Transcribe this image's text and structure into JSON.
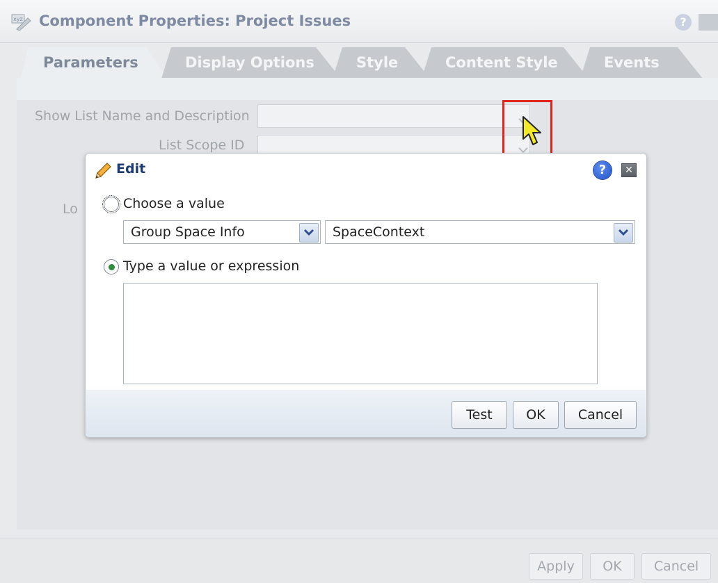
{
  "window": {
    "title": "Component Properties: Project Issues",
    "help_label": "?",
    "close_label": "✕"
  },
  "tabs": [
    {
      "label": "Parameters",
      "active": true
    },
    {
      "label": "Display Options",
      "active": false
    },
    {
      "label": "Style",
      "active": false
    },
    {
      "label": "Content Style",
      "active": false
    },
    {
      "label": "Events",
      "active": false
    }
  ],
  "form": {
    "field1_label": "Show List Name and Description",
    "field2_label": "List Scope ID",
    "field3_label_fragment": "Lo"
  },
  "bottom_buttons": {
    "apply": "Apply",
    "ok": "OK",
    "cancel": "Cancel"
  },
  "dialog": {
    "title": "Edit",
    "help_label": "?",
    "close_label": "✕",
    "option_choose": "Choose a value",
    "option_type": "Type a value or expression",
    "selected_option": "type",
    "select_category": "Group Space Info",
    "select_property": "SpaceContext",
    "expression_value": "",
    "buttons": {
      "test": "Test",
      "ok": "OK",
      "cancel": "Cancel"
    }
  },
  "colors": {
    "accent": "#1f51c6",
    "highlight": "#e2241d",
    "radio_selected": "#2d8f3c",
    "dialog_title": "#1d3a74"
  },
  "icons": {
    "bg_title": "expression-icon",
    "dialog_title": "pencil-icon",
    "cursor": "mouse-pointer-icon"
  }
}
